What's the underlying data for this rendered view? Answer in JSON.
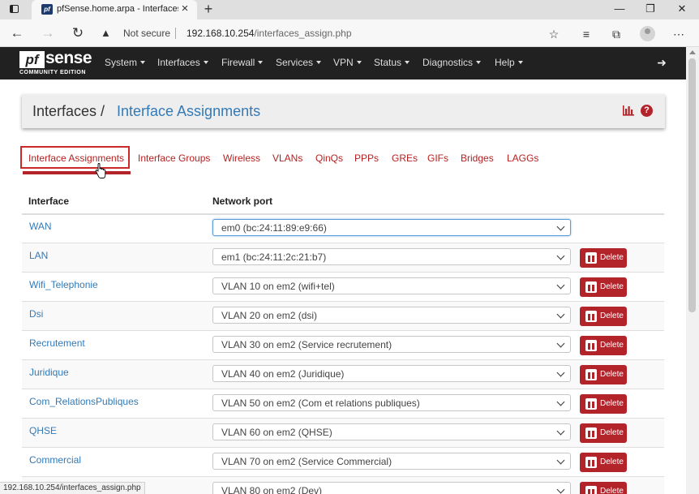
{
  "browser": {
    "tab_title": "pfSense.home.arpa - Interfaces: Interface Assignments",
    "tab_favicon": "pf",
    "close_tab_glyph": "×",
    "new_tab_glyph": "+",
    "minimize_glyph": "—",
    "restore_glyph": "❐",
    "close_window_glyph": "✕",
    "back_glyph": "←",
    "forward_glyph": "→",
    "reload_glyph": "↻",
    "warn_glyph": "▲",
    "security_label": "Not secure",
    "url_host": "192.168.10.254",
    "url_path": "/interfaces_assign.php",
    "status_url": "192.168.10.254/interfaces_assign.php",
    "toolbar_glyphs": {
      "favorite": "☆",
      "favorites_list": "≡",
      "collections": "⧉",
      "more": "⋯"
    }
  },
  "navbar": {
    "logo_pf": "pf",
    "logo_sense": "sense",
    "logo_edition": "COMMUNITY EDITION",
    "menu": [
      "System",
      "Interfaces",
      "Firewall",
      "Services",
      "VPN",
      "Status",
      "Diagnostics",
      "Help"
    ],
    "logout_glyph": "➜"
  },
  "breadcrumb": {
    "root": "Interfaces /",
    "current": "Interface Assignments",
    "help_glyph": "?"
  },
  "subtabs": [
    "Interface Assignments",
    "Interface Groups",
    "Wireless",
    "VLANs",
    "QinQs",
    "PPPs",
    "GREs",
    "GIFs",
    "Bridges",
    "LAGGs"
  ],
  "active_subtab": "Interface Assignments",
  "table": {
    "headers": {
      "interface": "Interface",
      "network_port": "Network port"
    },
    "delete_label": "Delete",
    "rows": [
      {
        "name": "WAN",
        "port": "em0 (bc:24:11:89:e9:66)"
      },
      {
        "name": "LAN",
        "port": "em1 (bc:24:11:2c:21:b7)"
      },
      {
        "name": "Wifi_Telephonie",
        "port": "VLAN 10 on em2 (wifi+tel)"
      },
      {
        "name": "Dsi",
        "port": "VLAN 20 on em2 (dsi)"
      },
      {
        "name": "Recrutement",
        "port": "VLAN 30 on em2 (Service recrutement)"
      },
      {
        "name": "Juridique",
        "port": "VLAN 40 on em2 (Juridique)"
      },
      {
        "name": "Com_RelationsPubliques",
        "port": "VLAN 50 on em2 (Com et relations publiques)"
      },
      {
        "name": "QHSE",
        "port": "VLAN 60 on em2 (QHSE)"
      },
      {
        "name": "Commercial",
        "port": "VLAN 70 on em2 (Service Commercial)"
      },
      {
        "name": "",
        "port": "VLAN 80 on em2 (Dev)"
      }
    ]
  },
  "colors": {
    "brand_red": "#b3232a",
    "link_blue": "#337ab7",
    "navbar_bg": "#212121"
  }
}
